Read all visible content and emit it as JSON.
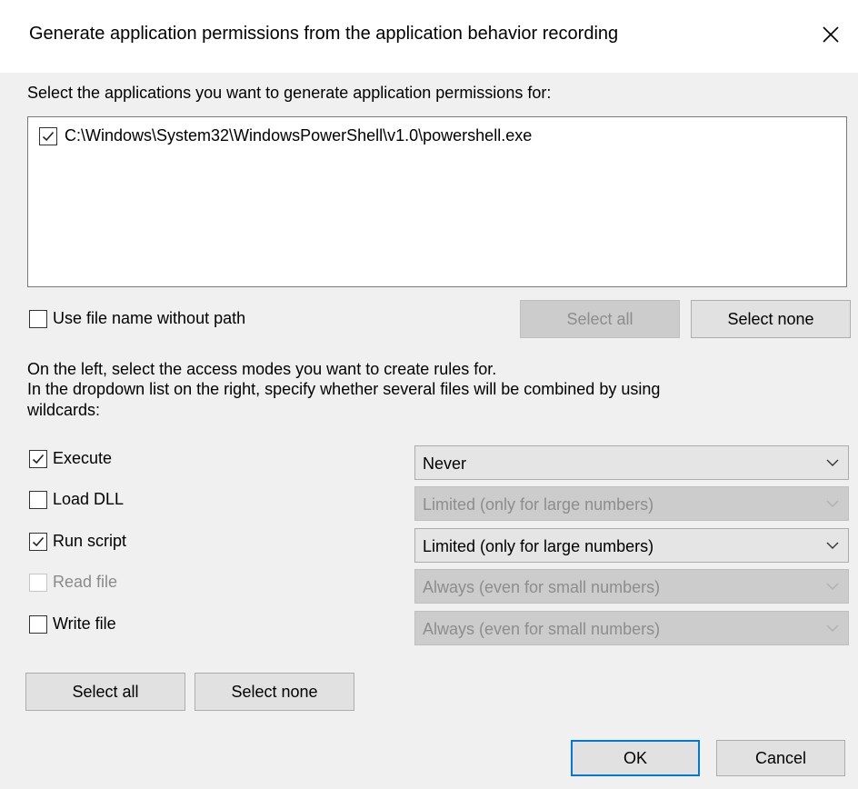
{
  "window": {
    "title": "Generate application permissions from the application behavior recording"
  },
  "applications": {
    "prompt": "Select the applications you want to generate application permissions for:",
    "items": [
      {
        "label": "C:\\Windows\\System32\\WindowsPowerShell\\v1.0\\powershell.exe",
        "checked": true
      }
    ],
    "use_file_name_label": "Use file name without path",
    "use_file_name_checked": false,
    "select_all_label": "Select all",
    "select_none_label": "Select none"
  },
  "access_modes": {
    "instructions_line1": "On the left, select the access modes you want to create rules for.",
    "instructions_line2": "In the dropdown list on the right, specify whether several files will be combined by using",
    "instructions_line3": "wildcards:",
    "modes": [
      {
        "label": "Execute",
        "checked": true,
        "enabled": true,
        "dropdown": "Never",
        "dropdown_enabled": true
      },
      {
        "label": "Load DLL",
        "checked": false,
        "enabled": true,
        "dropdown": "Limited (only for large numbers)",
        "dropdown_enabled": false
      },
      {
        "label": "Run script",
        "checked": true,
        "enabled": true,
        "dropdown": "Limited (only for large numbers)",
        "dropdown_enabled": true
      },
      {
        "label": "Read file",
        "checked": false,
        "enabled": false,
        "dropdown": "Always (even for small numbers)",
        "dropdown_enabled": false
      },
      {
        "label": "Write file",
        "checked": false,
        "enabled": true,
        "dropdown": "Always (even for small numbers)",
        "dropdown_enabled": false
      }
    ],
    "select_all_label": "Select all",
    "select_none_label": "Select none"
  },
  "footer": {
    "ok_label": "OK",
    "cancel_label": "Cancel"
  },
  "colors": {
    "accent": "#0078d7",
    "dialog_bg": "#f0f0f0"
  }
}
